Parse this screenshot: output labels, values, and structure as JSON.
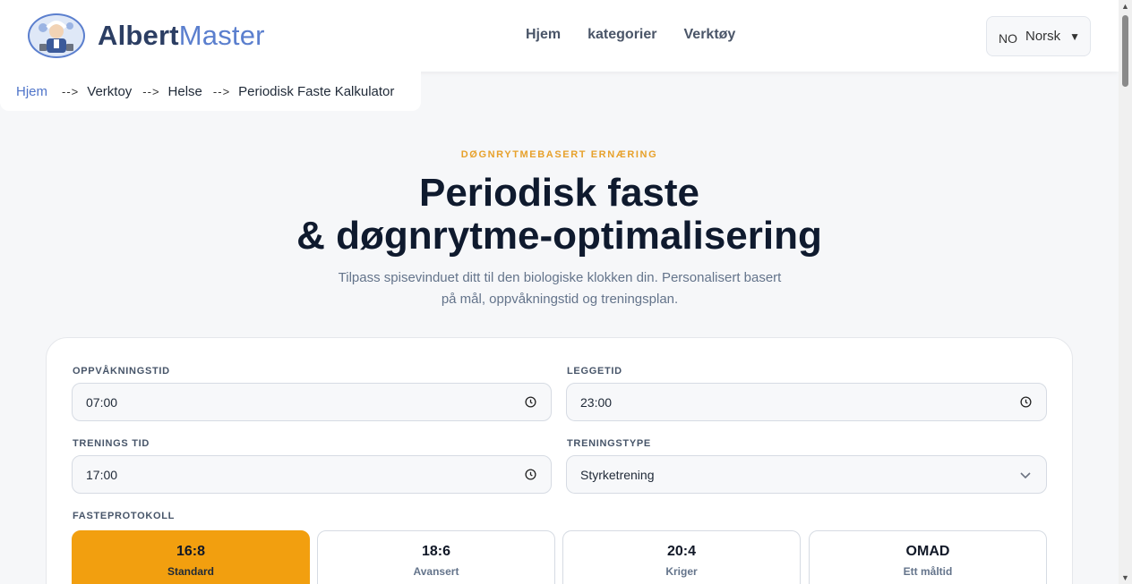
{
  "header": {
    "brand_part1": "Albert",
    "brand_part2": "Master",
    "nav": [
      "Hjem",
      "kategorier",
      "Verktøy"
    ],
    "language": {
      "code": "NO",
      "name": "Norsk"
    }
  },
  "breadcrumb": {
    "items": [
      "Hjem",
      "Verktoy",
      "Helse",
      "Periodisk Faste Kalkulator"
    ],
    "separator": "-->"
  },
  "hero": {
    "eyebrow": "DØGNRYTMEBASERT ERNÆRING",
    "title_line1": "Periodisk faste",
    "title_line2": "& døgnrytme-optimalisering",
    "subtitle": "Tilpass spisevinduet ditt til den biologiske klokken din. Personalisert basert på mål, oppvåkningstid og treningsplan."
  },
  "form": {
    "wake_label": "OPPVÅKNINGSTID",
    "wake_value": "07:00",
    "bed_label": "LEGGETID",
    "bed_value": "23:00",
    "training_time_label": "TRENINGS TID",
    "training_time_value": "17:00",
    "training_type_label": "TRENINGSTYPE",
    "training_type_value": "Styrketrening",
    "protocol_label": "FASTEPROTOKOLL",
    "protocols": [
      {
        "ratio": "16:8",
        "name": "Standard",
        "active": true
      },
      {
        "ratio": "18:6",
        "name": "Avansert",
        "active": false
      },
      {
        "ratio": "20:4",
        "name": "Kriger",
        "active": false
      },
      {
        "ratio": "OMAD",
        "name": "Ett måltid",
        "active": false
      }
    ]
  },
  "colors": {
    "accent": "#f29f0f",
    "brand_blue": "#5b7fce",
    "eyebrow": "#e7a12b",
    "title": "#0f1a2e"
  }
}
